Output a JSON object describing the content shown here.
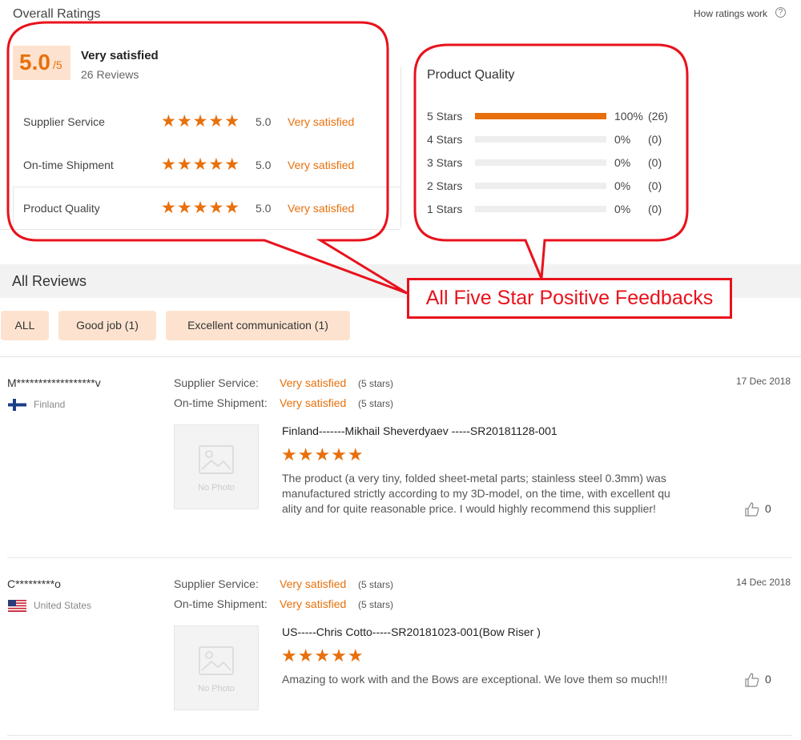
{
  "header": {
    "title": "Overall Ratings",
    "how_ratings": "How ratings work",
    "help_icon": "?"
  },
  "overall": {
    "score": "5.0",
    "scale": "/5",
    "label": "Very satisfied",
    "reviews": "26 Reviews",
    "star_glyphs": "★★★★★",
    "ratings": [
      {
        "label": "Supplier Service",
        "score": "5.0",
        "text": "Very satisfied",
        "stars": 5
      },
      {
        "label": "On-time Shipment",
        "score": "5.0",
        "text": "Very satisfied",
        "stars": 5
      },
      {
        "label": "Product Quality",
        "score": "5.0",
        "text": "Very satisfied",
        "stars": 5
      }
    ]
  },
  "product_quality": {
    "title": "Product Quality",
    "rows": [
      {
        "label": "5  Stars",
        "percent": "100%",
        "count": "(26)",
        "fill": 1.0
      },
      {
        "label": "4  Stars",
        "percent": "0%",
        "count": "(0)",
        "fill": 0
      },
      {
        "label": "3  Stars",
        "percent": "0%",
        "count": "(0)",
        "fill": 0
      },
      {
        "label": "2  Stars",
        "percent": "0%",
        "count": "(0)",
        "fill": 0
      },
      {
        "label": "1  Stars",
        "percent": "0%",
        "count": "(0)",
        "fill": 0
      }
    ]
  },
  "callout": {
    "text": "All Five Star Positive Feedbacks",
    "color": "#e8121c"
  },
  "all_reviews": {
    "title": "All Reviews",
    "tags": [
      {
        "label": "ALL"
      },
      {
        "label": "Good job (1)"
      },
      {
        "label": "Excellent communication (1)"
      }
    ]
  },
  "reviews": [
    {
      "reviewer": "M******************v",
      "country": "Finland",
      "date": "17 Dec 2018",
      "supplier_service_label": "Supplier Service:",
      "supplier_service_value": "Very satisfied",
      "supplier_service_stars": "(5 stars)",
      "shipment_label": "On-time Shipment:",
      "shipment_value": "Very satisfied",
      "shipment_stars": "(5 stars)",
      "photo_text": "No Photo",
      "title": "Finland-------Mikhail Sheverdyaev -----SR20181128-001",
      "stars": 5,
      "body_lines": [
        "The product (a very tiny, folded sheet-metal parts; stainless steel 0.3mm) was",
        "manufactured strictly according to my 3D-model, on the time, with excellent qu",
        "ality and for quite reasonable price. I would highly  recommend this supplier!"
      ],
      "likes": "0"
    },
    {
      "reviewer": "C*********o",
      "country": "United States",
      "date": "14 Dec 2018",
      "supplier_service_label": "Supplier Service:",
      "supplier_service_value": "Very satisfied",
      "supplier_service_stars": "(5 stars)",
      "shipment_label": "On-time Shipment:",
      "shipment_value": "Very satisfied",
      "shipment_stars": "(5 stars)",
      "photo_text": "No Photo",
      "title": "US-----Chris Cotto-----SR20181023-001(Bow Riser )",
      "stars": 5,
      "body_lines": [
        "Amazing to work with and the Bows are exceptional. We love them so much!!!"
      ],
      "likes": "0"
    }
  ],
  "colors": {
    "accent": "#e8700c",
    "tag_bg": "#fde3cf",
    "annotation": "#e8121c"
  }
}
